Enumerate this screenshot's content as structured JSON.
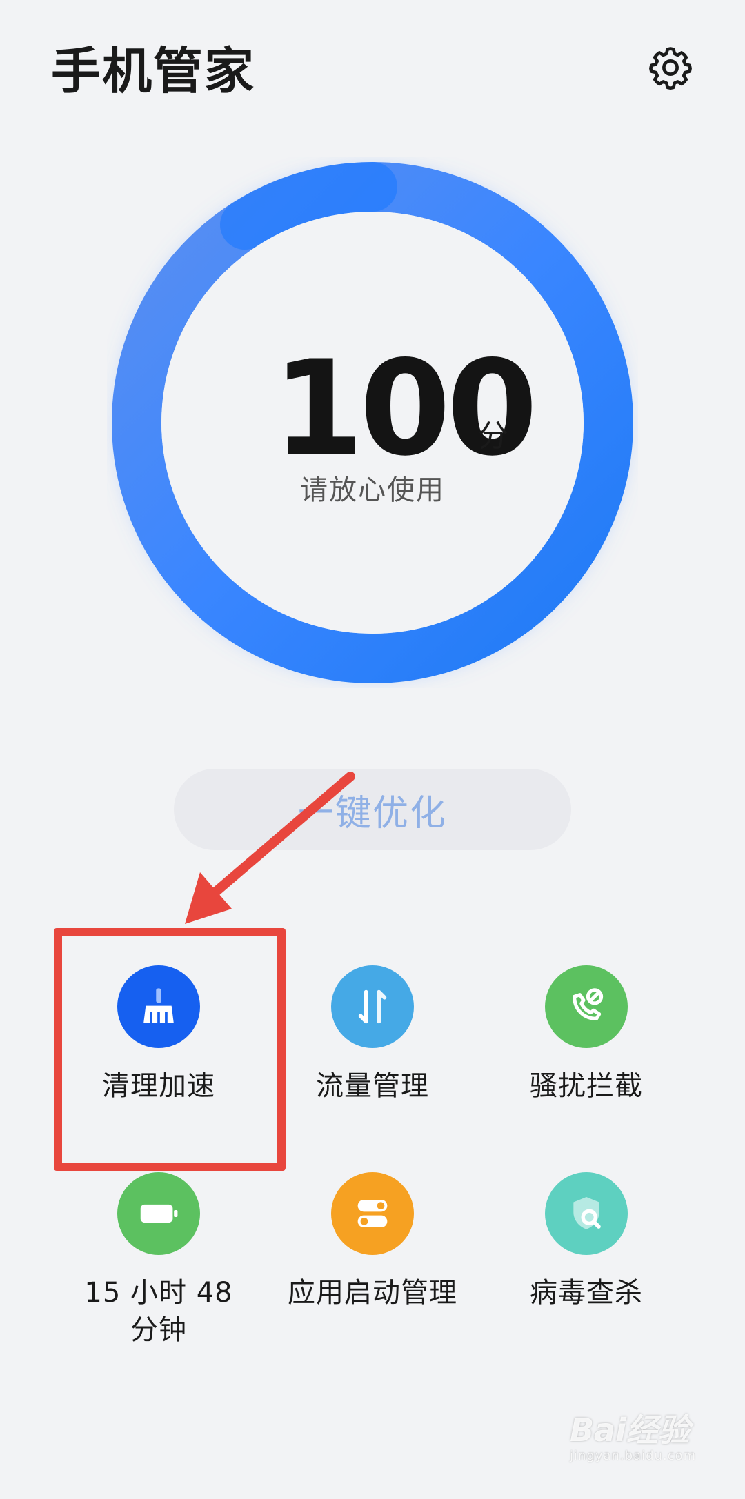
{
  "header": {
    "title": "手机管家",
    "settings_icon": "gear-icon"
  },
  "score": {
    "value": "100",
    "unit": "分",
    "status": "请放心使用",
    "progress": 1.0,
    "ring_color_start": "#1677ff",
    "ring_color_end": "#5b8ff0"
  },
  "optimize": {
    "label": "一键优化"
  },
  "tools": [
    {
      "label": "清理加速",
      "icon": "broom-icon",
      "color": "#1660f0"
    },
    {
      "label": "流量管理",
      "icon": "data-transfer-icon",
      "color": "#45a9e6"
    },
    {
      "label": "骚扰拦截",
      "icon": "phone-block-icon",
      "color": "#5cc160"
    },
    {
      "label": "15 小时 48 分钟",
      "icon": "battery-icon",
      "color": "#5cc160"
    },
    {
      "label": "应用启动管理",
      "icon": "toggle-switch-icon",
      "color": "#f6a122"
    },
    {
      "label": "病毒查杀",
      "icon": "shield-search-icon",
      "color": "#5ed0c0"
    }
  ],
  "annotation": {
    "color": "#e8463d"
  },
  "watermark": {
    "brand": "Bai经验",
    "url": "jingyan.baidu.com"
  }
}
